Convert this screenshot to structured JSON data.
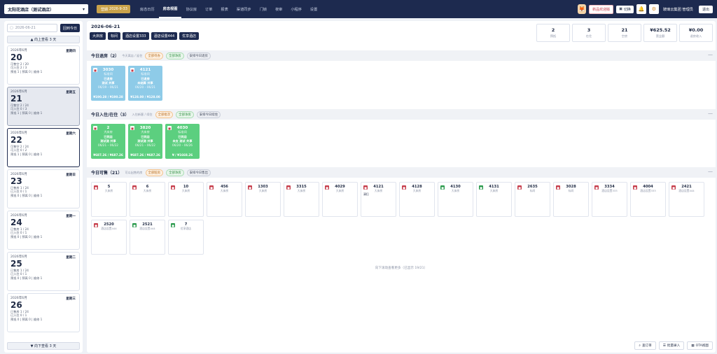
{
  "topbar": {
    "hotel": "太阳花酒店（测试酒店）",
    "date_label": "营期",
    "date_value": "2026-9-33",
    "nav": [
      "房态日历",
      "房态视图",
      "协议房",
      "订单",
      "报表",
      "渠道同步",
      "门锁",
      "夜审",
      "小程序",
      "设置"
    ],
    "active_nav": 1,
    "tag_new": "新品欢迎版",
    "switch_label": "切换",
    "user": "玻璃云集团 管理员",
    "logout": "退出"
  },
  "sidebar": {
    "date_placeholder": "2026-06-21",
    "today_btn": "回到今日",
    "up_btn": "▲ 向上查看 3 天",
    "down_btn": "▼ 向下查看 3 天",
    "days": [
      {
        "ym": "2026年6月",
        "day": "20",
        "week": "星期四",
        "l1": "可售空 2 / 20",
        "l2": "可入住 2 / 3",
        "l3": "预抵 1 | 预离 0 | 维修 1"
      },
      {
        "ym": "2026年6月",
        "day": "21",
        "week": "星期五",
        "l1": "可售空 2 / 24",
        "l2": "可入住 0 / 3",
        "l3": "预抵 1 | 预离 0 | 维修 1"
      },
      {
        "ym": "2026年6月",
        "day": "22",
        "week": "星期六",
        "l1": "可售空 2 / 24",
        "l2": "可入住 0 / 2",
        "l3": "预抵 1 | 预离 0 | 维修 1"
      },
      {
        "ym": "2026年6月",
        "day": "23",
        "week": "星期日",
        "l1": "已售房 1 / 24",
        "l2": "已入住 0 / 1",
        "l3": "预抵 0 | 预离 0 | 维修 1"
      },
      {
        "ym": "2026年6月",
        "day": "24",
        "week": "星期一",
        "l1": "已售房 1 / 24",
        "l2": "已入住 0 / 1",
        "l3": "预抵 0 | 预离 0 | 维修 1"
      },
      {
        "ym": "2026年6月",
        "day": "25",
        "week": "星期二",
        "l1": "已售房 1 / 24",
        "l2": "已入住 0 / 1",
        "l3": "预抵 0 | 预离 0 | 维修 1"
      },
      {
        "ym": "2026年6月",
        "day": "26",
        "week": "星期三",
        "l1": "已售房 1 / 24",
        "l2": "已入住 0 / 1",
        "l3": "预抵 0 | 预离 0 | 维修 1"
      }
    ]
  },
  "main": {
    "date": "2026-06-21",
    "tags": [
      "大床房",
      "标间",
      "酒店设置333",
      "酒店设置444",
      "优享酒店"
    ],
    "stats": [
      {
        "v": "2",
        "l": "预抵"
      },
      {
        "v": "3",
        "l": "在住"
      },
      {
        "v": "21",
        "l": "空房"
      },
      {
        "v": "¥625.52",
        "l": "营业额"
      },
      {
        "v": "¥0.00",
        "l": "退房收入"
      }
    ],
    "sec1": {
      "title": "今日退房（2）",
      "sub": "今天离店 / 延住",
      "chips": [
        "全部待办",
        "全部净房",
        "安排今日退房"
      ]
    },
    "sec2": {
      "title": "今日入住/在住（3）",
      "sub": "入住新客 / 续住",
      "chips": [
        "全部批次",
        "全部净房",
        "安排今日续住"
      ]
    },
    "sec3": {
      "title": "今日可售（21）",
      "sub": "可以出售的房",
      "chips": [
        "全部脏房",
        "全部净房",
        "安排今日售出"
      ]
    },
    "checkout_rooms": [
      {
        "no": "3030",
        "type": "标准间",
        "st": "已退房",
        "name": "测试 共享",
        "date": "06/19 – 06/21",
        "price": "¥190.28 / ¥190.28"
      },
      {
        "no": "4121",
        "type": "标准间",
        "st": "已退房",
        "name": "未结算 共享",
        "date": "06/20 – 06/21",
        "price": "¥128.00 / ¥128.00"
      }
    ],
    "stay_rooms": [
      {
        "no": "2",
        "type": "大床房",
        "st": "已到店",
        "name": "测试测 共享",
        "date": "06/21 – 06/22",
        "price": "¥687.26 / ¥687.26"
      },
      {
        "no": "3820",
        "type": "大床房",
        "st": "已到店",
        "name": "测试测 共享",
        "date": "06/21 – 06/22",
        "price": "¥687.26 / ¥687.26"
      },
      {
        "no": "4030",
        "type": "标准间",
        "st": "已到店",
        "name": "未支 测试 共享",
        "date": "06/20 – 06/26",
        "price": "¥ / ¥1668.26"
      }
    ],
    "vacant_rooms": [
      {
        "no": "5",
        "t": "大床房",
        "b": "r",
        "x": ""
      },
      {
        "no": "6",
        "t": "大床房",
        "b": "r",
        "x": ""
      },
      {
        "no": "10",
        "t": "大床房",
        "b": "r",
        "x": ""
      },
      {
        "no": "456",
        "t": "大床房",
        "b": "r",
        "x": ""
      },
      {
        "no": "1303",
        "t": "大床房",
        "b": "r",
        "x": ""
      },
      {
        "no": "3315",
        "t": "大床房",
        "b": "r",
        "x": ""
      },
      {
        "no": "4029",
        "t": "大床房",
        "b": "r",
        "x": ""
      },
      {
        "no": "4121",
        "t": "大床房",
        "b": "r",
        "x": "清扫"
      },
      {
        "no": "4128",
        "t": "大床房",
        "b": "r",
        "x": ""
      },
      {
        "no": "4130",
        "t": "大床房",
        "b": "g",
        "x": ""
      },
      {
        "no": "4131",
        "t": "大床房",
        "b": "g",
        "x": ""
      },
      {
        "no": "2635",
        "t": "标间",
        "b": "r",
        "x": ""
      },
      {
        "no": "3028",
        "t": "标间",
        "b": "r",
        "x": ""
      },
      {
        "no": "3334",
        "t": "酒店设置333",
        "b": "r",
        "x": ""
      },
      {
        "no": "4004",
        "t": "酒店设置333",
        "b": "r",
        "x": ""
      },
      {
        "no": "2421",
        "t": "酒店设置444",
        "b": "r",
        "x": ""
      },
      {
        "no": "2520",
        "t": "酒店设置444",
        "b": "r",
        "x": ""
      },
      {
        "no": "2521",
        "t": "酒店设置444",
        "b": "g",
        "x": ""
      },
      {
        "no": "7",
        "t": "优享酒店",
        "b": "g",
        "x": ""
      }
    ],
    "footer_hint": "向下滚动查看更多（已显示 19/21）",
    "fabs": [
      "查订单",
      "批量录入",
      "OTA视图"
    ]
  }
}
